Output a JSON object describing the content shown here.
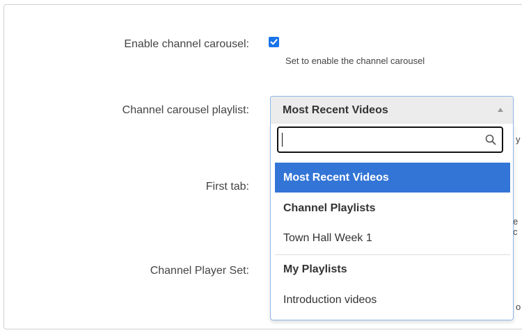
{
  "form": {
    "enable_carousel_label": "Enable channel carousel:",
    "enable_carousel_hint": "Set to enable the channel carousel",
    "enable_carousel_checked": true,
    "carousel_playlist_label": "Channel carousel playlist:",
    "first_tab_label": "First tab:",
    "player_set_label": "Channel Player Set:"
  },
  "select": {
    "value": "Most Recent Videos",
    "search_value": ""
  },
  "dropdown": {
    "options": [
      {
        "label": "Most Recent Videos",
        "type": "option",
        "selected": true
      },
      {
        "label": "Channel Playlists",
        "type": "group"
      },
      {
        "label": "Town Hall Week 1",
        "type": "option"
      },
      {
        "label": "My Playlists",
        "type": "group"
      },
      {
        "label": "Introduction videos",
        "type": "option"
      }
    ]
  },
  "peeking_text": {
    "row1": "y",
    "row2": "e c",
    "row3": "o"
  },
  "colors": {
    "accent": "#3375d6",
    "checkbox": "#1a73e8",
    "select_border": "#8fb6e6"
  },
  "icons": {
    "checkbox": "check-icon",
    "search": "search-icon",
    "caret": "caret-up-icon"
  }
}
